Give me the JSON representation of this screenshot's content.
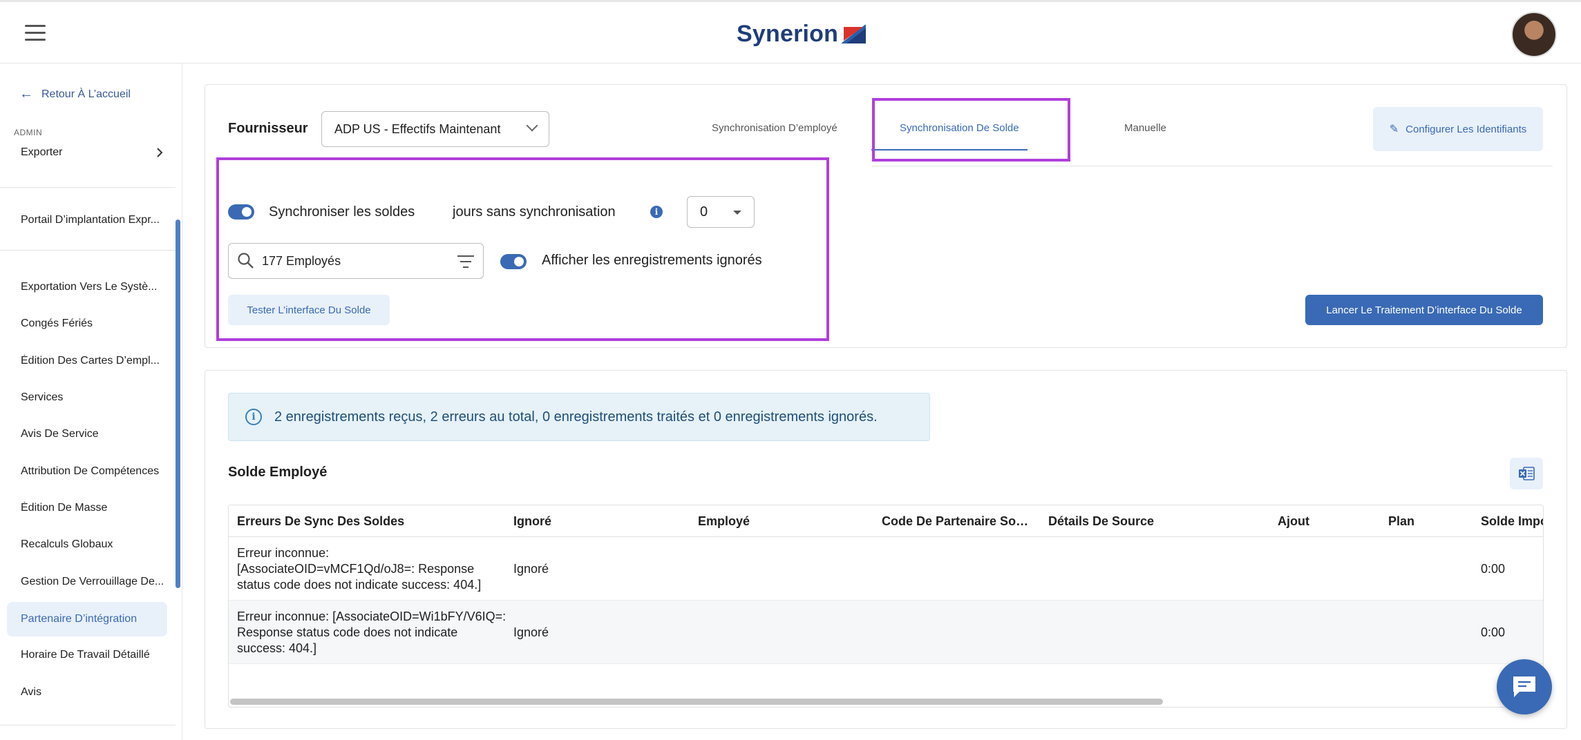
{
  "header": {
    "logo_text": "Synerion",
    "brand_color": "#1f3d7a"
  },
  "sidebar": {
    "back_label": "Retour À L’accueil",
    "section_label": "ADMIN",
    "export_label": "Exporter",
    "items": [
      {
        "label": "Portail D’implantation Expr..."
      },
      {
        "label": "Exportation Vers Le Systè..."
      },
      {
        "label": "Congés Fériés"
      },
      {
        "label": "Édition Des Cartes D’empl..."
      },
      {
        "label": "Services"
      },
      {
        "label": "Avis De Service"
      },
      {
        "label": "Attribution De Compétences"
      },
      {
        "label": "Édition De Masse"
      },
      {
        "label": "Recalculs Globaux"
      },
      {
        "label": "Gestion De Verrouillage De..."
      },
      {
        "label": "Partenaire D’intégration",
        "active": true
      },
      {
        "label": "Horaire De Travail Détaillé"
      },
      {
        "label": "Avis"
      }
    ]
  },
  "config": {
    "provider_label": "Fournisseur",
    "provider_value": "ADP US - Effectifs Maintenant",
    "tabs": [
      {
        "label": "Synchronisation D’employé"
      },
      {
        "label": "Synchronisation De Solde",
        "active": true
      },
      {
        "label": "Manuelle"
      }
    ],
    "configure_button": "Configurer Les Identifiants",
    "sync_balances_label": "Synchroniser les soldes",
    "days_without_sync_label": "jours sans synchronisation",
    "days_value": "0",
    "search_value": "177 Employés",
    "show_ignored_label": "Afficher les enregistrements ignorés",
    "test_button": "Tester L’interface Du Solde",
    "launch_button": "Lancer Le Traitement D’interface Du Solde"
  },
  "results": {
    "alert_text": "2 enregistrements reçus, 2 erreurs au total, 0 enregistrements traités et 0 enregistrements ignorés.",
    "table_title": "Solde Employé",
    "columns": [
      "Erreurs De Sync Des Soldes",
      "Ignoré",
      "Employé",
      "Code De Partenaire Sou...",
      "Détails De Source",
      "Ajout",
      "Plan",
      "Solde Impo"
    ],
    "rows": [
      {
        "error": "Erreur inconnue: [AssociateOID=vMCF1Qd/oJ8=: Response status code does not indicate success: 404.]",
        "ignored": "Ignoré",
        "employee": "",
        "partner_code": "",
        "source_details": "",
        "added": "",
        "plan": "",
        "balance": "0:00"
      },
      {
        "error": "Erreur inconnue: [AssociateOID=Wi1bFY/V6IQ=: Response status code does not indicate success: 404.]",
        "ignored": "Ignoré",
        "employee": "",
        "partner_code": "",
        "source_details": "",
        "added": "",
        "plan": "",
        "balance": "0:00"
      }
    ]
  },
  "colors": {
    "accent": "#3a6ab5",
    "highlight": "#b03fdc",
    "alert_bg": "#e6f2f8"
  }
}
